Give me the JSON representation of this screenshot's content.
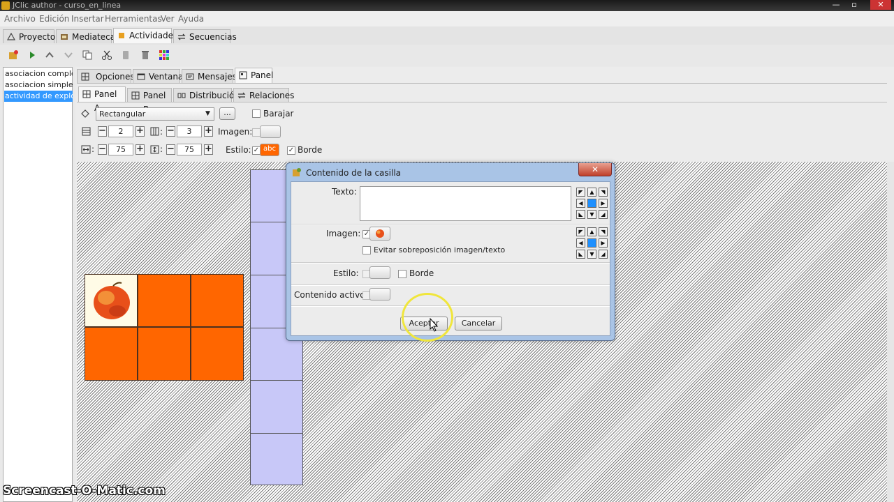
{
  "window": {
    "title": "JClic author - curso_en_linea",
    "min": "—",
    "max": "▫",
    "close": "✕"
  },
  "menu": [
    "Archivo",
    "Edición",
    "Insertar",
    "Herramientas",
    "Ver",
    "Ayuda"
  ],
  "top_tabs": [
    "Proyecto",
    "Mediateca",
    "Actividades",
    "Secuencias"
  ],
  "activities": [
    "asociacion compleja",
    "asociacion simple",
    "actividad de explora"
  ],
  "sub_tabs": [
    "Opciones",
    "Ventana",
    "Mensajes",
    "Panel"
  ],
  "panel_tabs": [
    "Panel A",
    "Panel B",
    "Distribución",
    "Relaciones"
  ],
  "shape": {
    "value": "Rectangular",
    "more": "...",
    "barajar": "Barajar"
  },
  "grid": {
    "rows": "2",
    "cols": "3",
    "imagen_label": "Imagen:"
  },
  "size": {
    "width": "75",
    "height": "75",
    "estilo_label": "Estilo:",
    "estilo_swatch": "abc",
    "borde_label": "Borde"
  },
  "dialog": {
    "title": "Contenido de la casilla",
    "texto_label": "Texto:",
    "imagen_label": "Imagen:",
    "evitar_label": "Evitar sobreposición imagen/texto",
    "estilo_label": "Estilo:",
    "borde_label": "Borde",
    "activo_label": "Contenido activo:",
    "aceptar": "Aceptar",
    "cancelar": "Cancelar"
  },
  "colors": {
    "orange": "#ff6600",
    "lavender": "#c8c8f8",
    "accent": "#3399ff"
  },
  "watermark": "Screencast-O-Matic.com"
}
